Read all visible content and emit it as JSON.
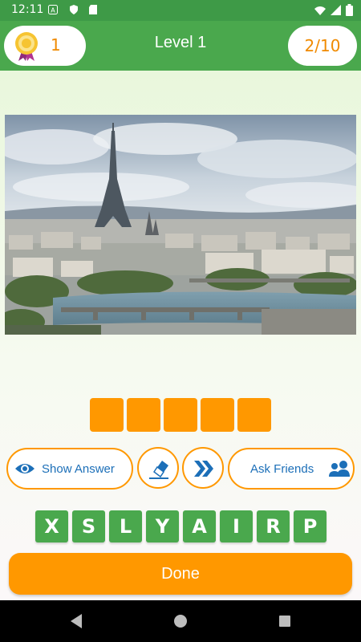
{
  "status_bar": {
    "time": "12:11",
    "icons": [
      "a-icon",
      "shield-icon",
      "sd-card-icon",
      "wifi-icon",
      "signal-icon",
      "battery-icon"
    ]
  },
  "header": {
    "coins": "1",
    "title": "Level 1",
    "progress": "2/10"
  },
  "puzzle": {
    "image": "paris-eiffel-tower-photo",
    "answer_slots": 5
  },
  "hints": {
    "show_answer_label": "Show Answer",
    "ask_friends_label": "Ask Friends",
    "eraser_icon": "eraser-icon",
    "skip_icon": "skip-icon"
  },
  "letters": [
    "X",
    "S",
    "L",
    "Y",
    "A",
    "I",
    "R",
    "P"
  ],
  "done_label": "Done",
  "colors": {
    "green": "#4aa84d",
    "dark_green": "#3e9a47",
    "orange": "#ff9800",
    "blue": "#1c6fb8"
  }
}
